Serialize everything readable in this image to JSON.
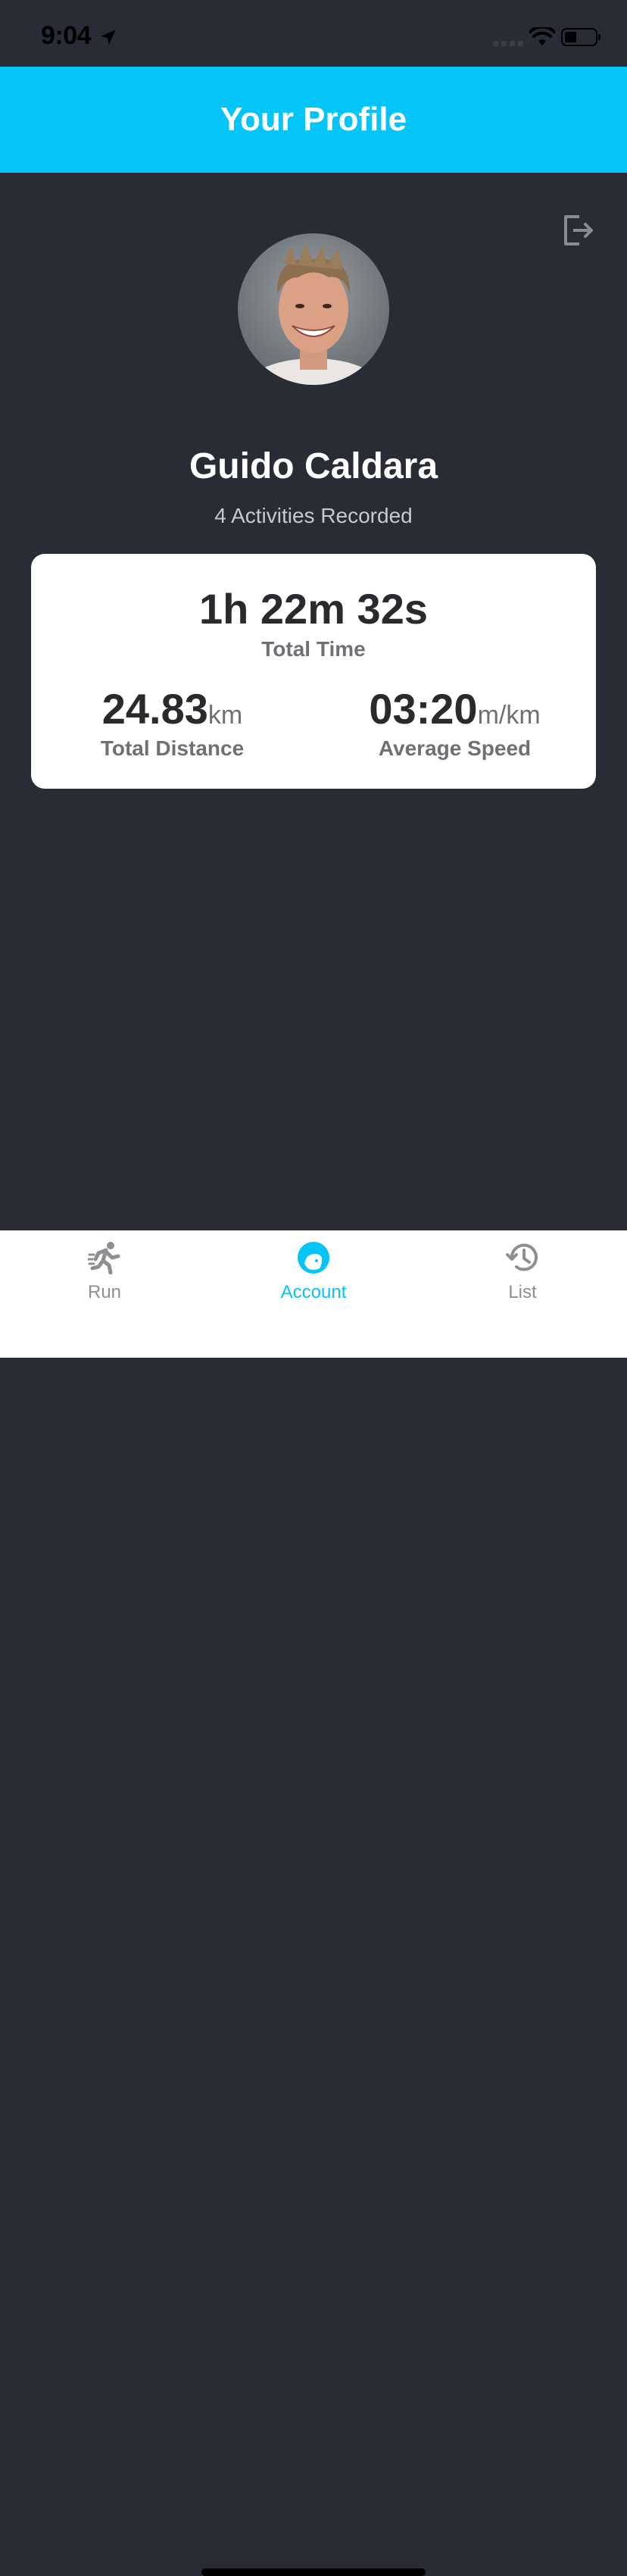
{
  "status_bar": {
    "time": "9:04",
    "icons": [
      "location-arrow-icon",
      "signal-icon",
      "wifi-icon",
      "battery-icon"
    ]
  },
  "header": {
    "title": "Your Profile",
    "background_color": "#05c4f8"
  },
  "profile": {
    "name": "Guido Caldara",
    "activities": "4 Activities Recorded",
    "logout_icon": "logout-icon",
    "avatar_icon": "avatar-photo"
  },
  "stats": {
    "total_time": {
      "value": "1h 22m 32s",
      "label": "Total Time"
    },
    "total_distance": {
      "value": "24.83",
      "unit": "km",
      "label": "Total Distance"
    },
    "average_speed": {
      "value": "03:20",
      "unit": "m/km",
      "label": "Average Speed"
    }
  },
  "tab_bar": {
    "tabs": [
      {
        "label": "Run",
        "icon": "runner-icon",
        "active": false
      },
      {
        "label": "Account",
        "icon": "account-icon",
        "active": true
      },
      {
        "label": "List",
        "icon": "history-icon",
        "active": false
      }
    ],
    "active_color": "#05c4f8",
    "inactive_color": "#8e8e93"
  }
}
